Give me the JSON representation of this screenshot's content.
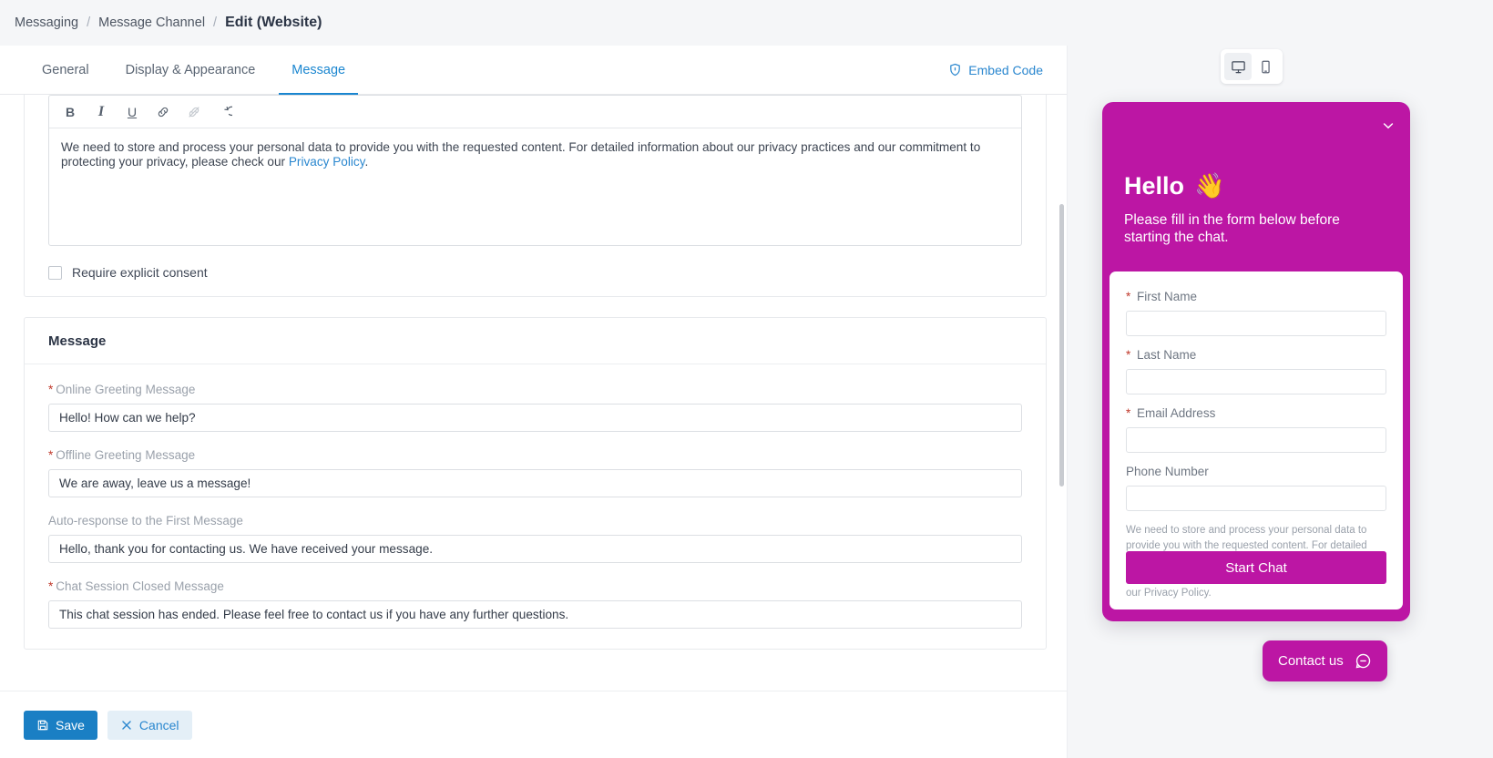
{
  "breadcrumb": {
    "root": "Messaging",
    "parent": "Message Channel",
    "current": "Edit (Website)",
    "separator": "/"
  },
  "tabs": [
    {
      "label": "General",
      "active": false
    },
    {
      "label": "Display & Appearance",
      "active": false
    },
    {
      "label": "Message",
      "active": true
    }
  ],
  "embed": {
    "label": "Embed Code",
    "icon": "shield-icon"
  },
  "editor": {
    "toolbar": [
      {
        "name": "bold",
        "glyph": "B",
        "disabled": false
      },
      {
        "name": "italic",
        "glyph": "I",
        "disabled": false
      },
      {
        "name": "underline",
        "glyph": "U",
        "disabled": false
      },
      {
        "name": "link",
        "glyph": "link",
        "disabled": false
      },
      {
        "name": "unlink",
        "glyph": "unlink",
        "disabled": true
      },
      {
        "name": "undo",
        "glyph": "undo",
        "disabled": false
      }
    ],
    "text_before_link": "We need to store and process your personal data to provide you with the requested content. For detailed information about our privacy practices and our commitment to protecting your privacy, please check our ",
    "link_text": "Privacy Policy",
    "text_after_link": "."
  },
  "consent": {
    "checkbox_label": "Require explicit consent",
    "checked": false
  },
  "message_section": {
    "title": "Message",
    "fields": [
      {
        "label": "Online Greeting Message",
        "required": true,
        "value": "Hello! How can we help?"
      },
      {
        "label": "Offline Greeting Message",
        "required": true,
        "value": "We are away, leave us a message!"
      },
      {
        "label": "Auto-response to the First Message",
        "required": false,
        "value": "Hello, thank you for contacting us. We have received your message."
      },
      {
        "label": "Chat Session Closed Message",
        "required": true,
        "value": "This chat session has ended. Please feel free to contact us if you have any further questions."
      }
    ]
  },
  "actions": {
    "save": "Save",
    "cancel": "Cancel"
  },
  "preview": {
    "device_desktop": "desktop-icon",
    "device_mobile": "mobile-icon",
    "active_device": "desktop",
    "widget": {
      "title": "Hello",
      "title_emoji": "👋",
      "subtitle": "Please fill in the form below before starting the chat.",
      "collapse_icon": "chevron-down-icon",
      "fields": [
        {
          "label": "First Name",
          "required": true,
          "value": ""
        },
        {
          "label": "Last Name",
          "required": true,
          "value": ""
        },
        {
          "label": "Email Address",
          "required": true,
          "value": ""
        },
        {
          "label": "Phone Number",
          "required": false,
          "value": ""
        }
      ],
      "consent_text": "We need to store and process your personal data to provide you with the requested content. For detailed information about our privacy practices and our commitment to protecting your privacy, please check our Privacy Policy.",
      "start_button": "Start Chat"
    },
    "launcher": {
      "label": "Contact us",
      "icon": "chat-bubble-icon"
    }
  },
  "colors": {
    "accent_blue": "#1a7fc4",
    "tab_active": "#1a86d0",
    "widget_magenta": "#bc16a4",
    "required_red": "#c0392b"
  }
}
